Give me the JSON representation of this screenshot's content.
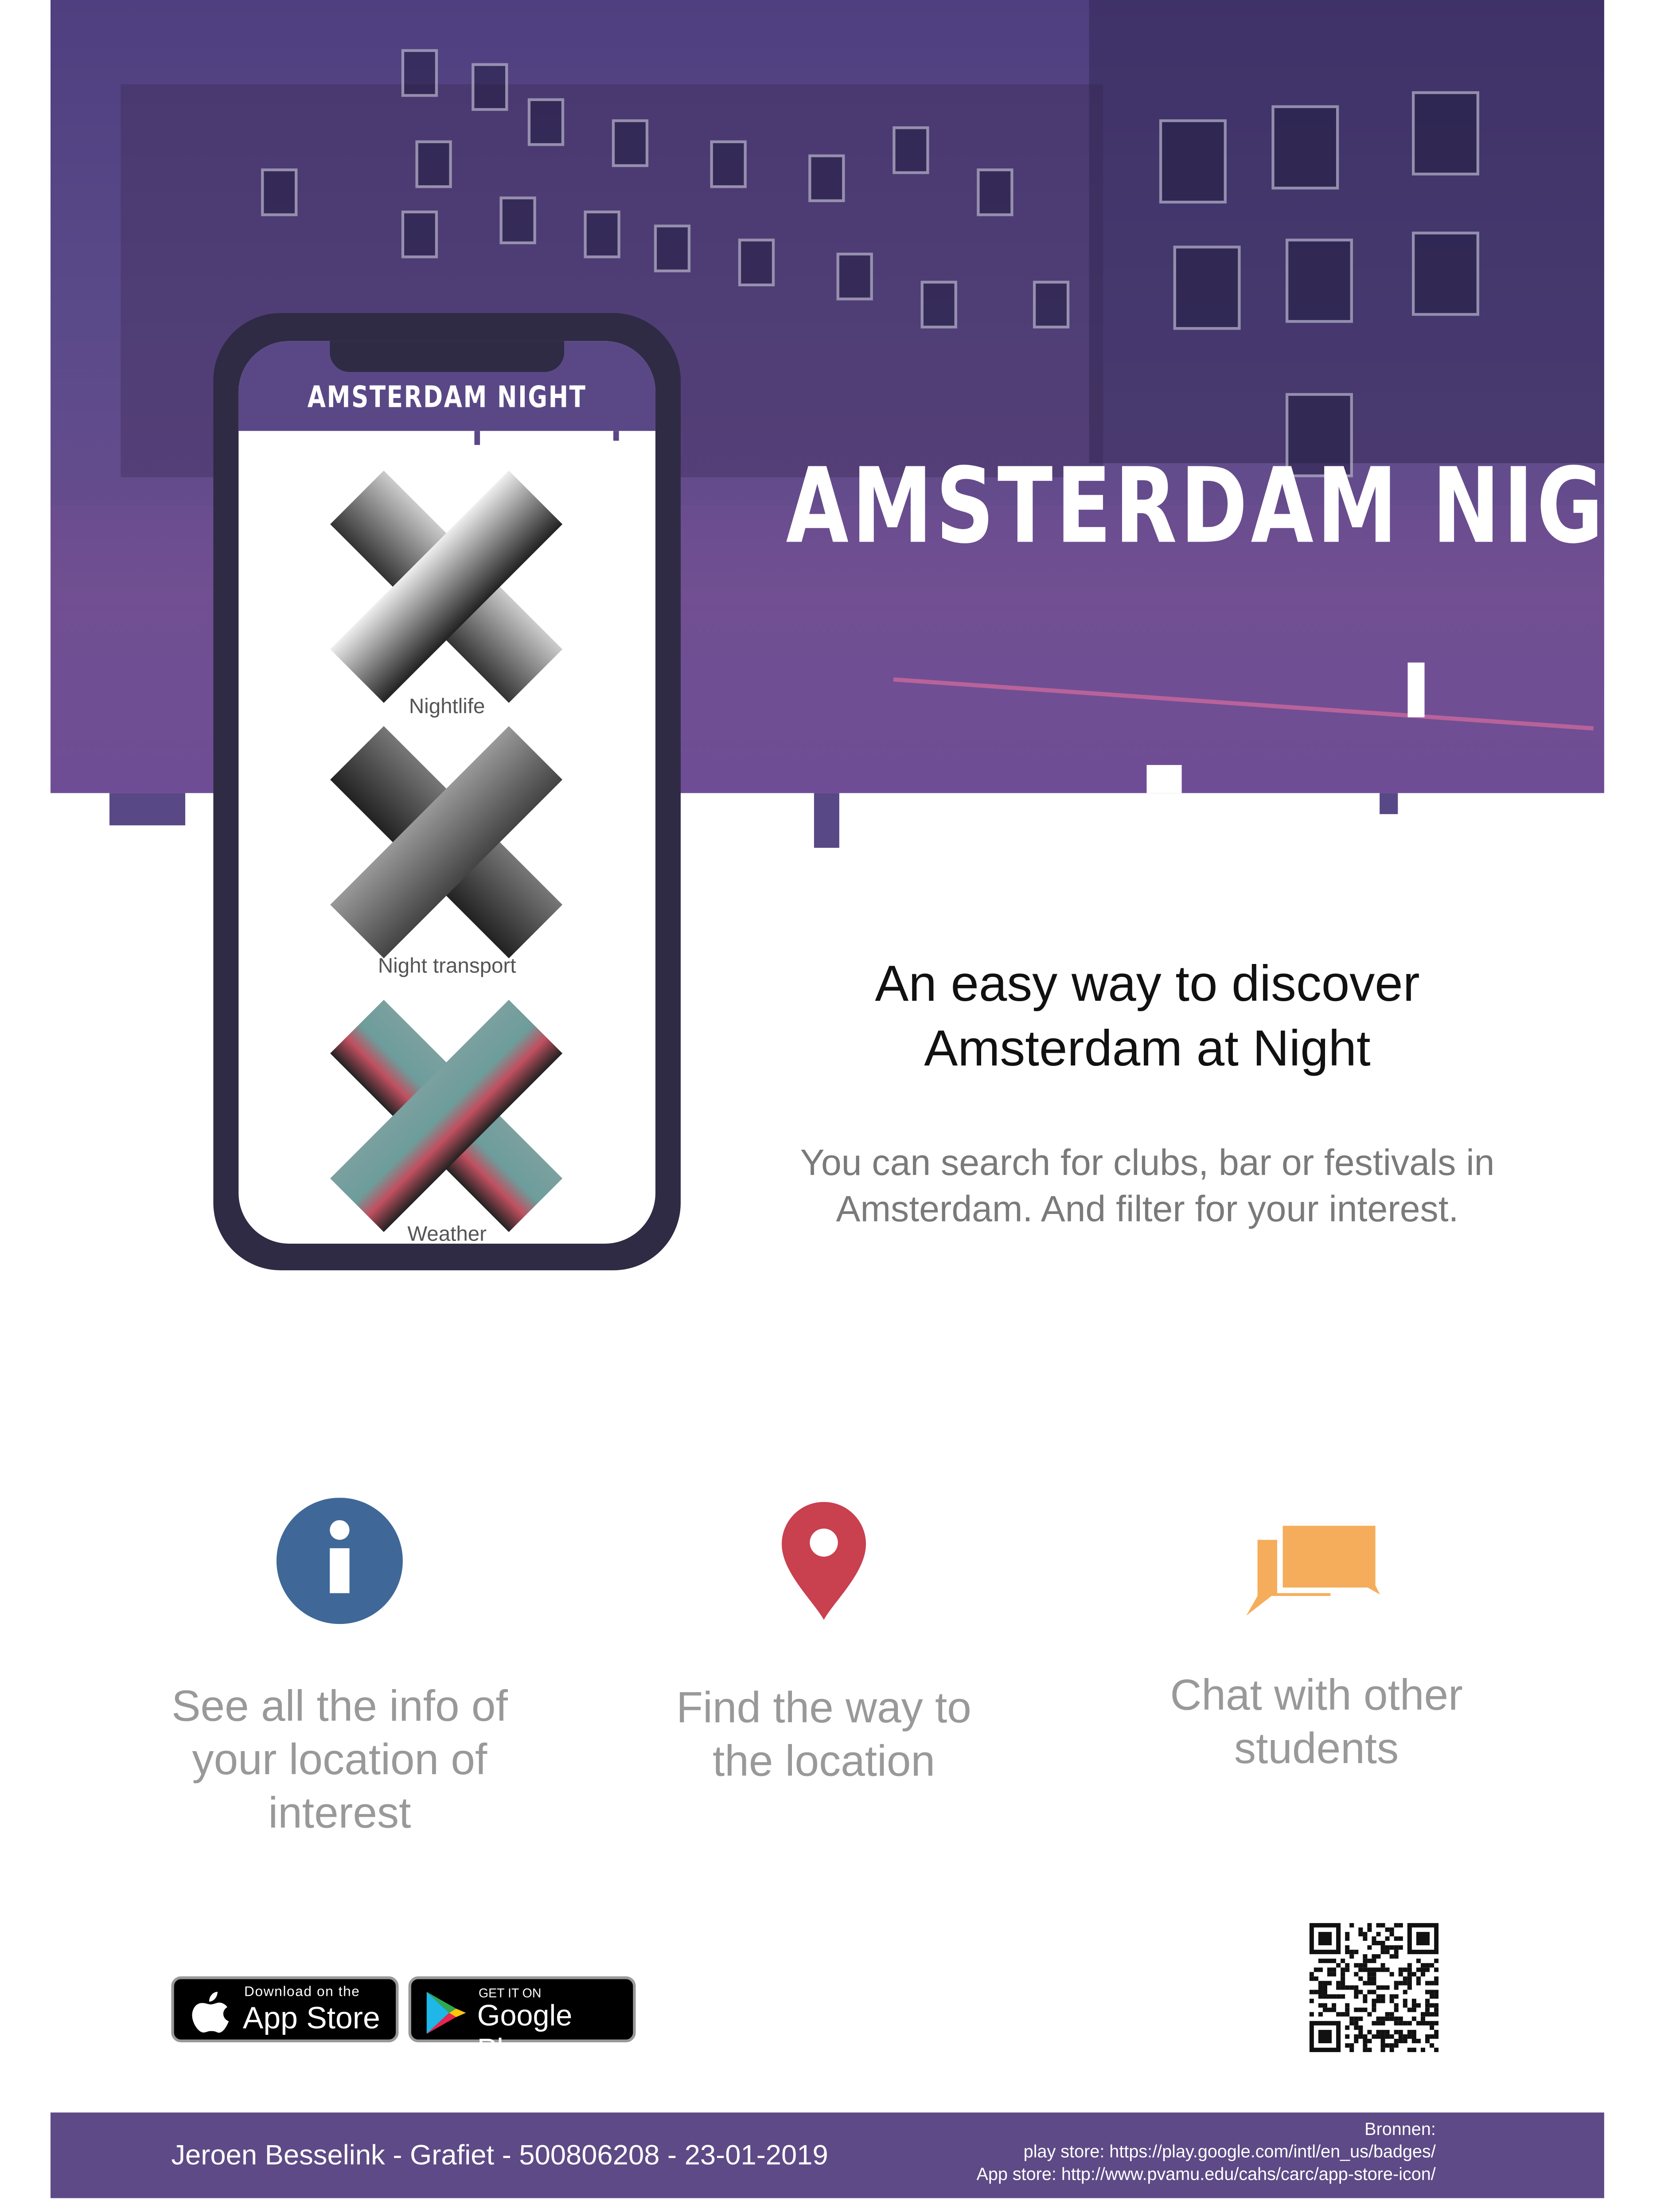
{
  "hero": {
    "title": "AMSTERDAM NIGHT"
  },
  "phone": {
    "app_title": "AMSTERDAM NIGHT",
    "items": [
      {
        "label": "Nightlife"
      },
      {
        "label": "Night transport"
      },
      {
        "label": "Weather"
      }
    ]
  },
  "intro": {
    "headline_line1": "An easy way to discover",
    "headline_line2": "Amsterdam at Night",
    "desc_line1": "You can search for clubs, bar or festivals in",
    "desc_line2": "Amsterdam. And filter for your interest."
  },
  "features": [
    {
      "icon": "info-icon",
      "color": "#3f6898",
      "lines": [
        "See all the info of",
        "your location of",
        "interest"
      ]
    },
    {
      "icon": "map-pin-icon",
      "color": "#c9404f",
      "lines": [
        "Find the way to",
        "the location"
      ]
    },
    {
      "icon": "chat-icon",
      "color": "#f5ad5b",
      "lines": [
        "Chat with other",
        "students"
      ]
    }
  ],
  "badges": {
    "appstore_small": "Download on the",
    "appstore_big": "App Store",
    "googleplay_small": "GET IT ON",
    "googleplay_big": "Google Play"
  },
  "footer": {
    "credit": "Jeroen Besselink - Grafiet - 500806208 - 23-01-2019",
    "sources_label": "Bronnen:",
    "source_play": "play store: https://play.google.com/intl/en_us/badges/",
    "source_app": "App store: http://www.pvamu.edu/cahs/carc/app-store-icon/"
  },
  "colors": {
    "brand": "#5a4886",
    "phone": "#2f2b45"
  }
}
